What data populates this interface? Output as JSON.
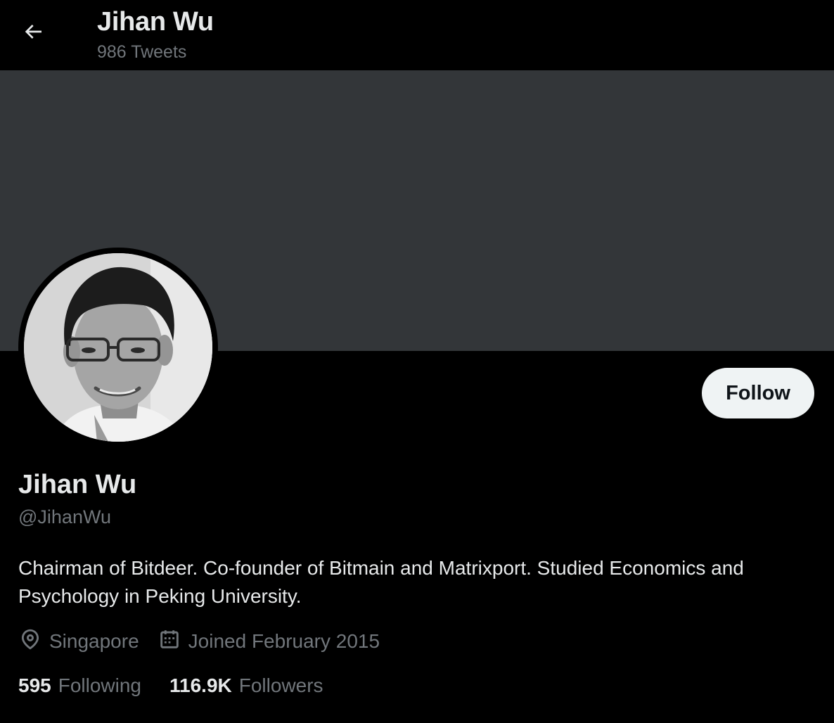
{
  "header": {
    "back_icon": "arrow-left-icon",
    "title": "Jihan Wu",
    "tweet_count": "986 Tweets"
  },
  "banner": {
    "color": "#333639"
  },
  "profile": {
    "name": "Jihan Wu",
    "handle": "@JihanWu",
    "bio": "Chairman of Bitdeer. Co-founder of Bitmain and Matrixport. Studied Economics and Psychology in Peking University.",
    "location": "Singapore",
    "location_icon": "location-pin-icon",
    "joined": "Joined February 2015",
    "joined_icon": "calendar-icon",
    "follow_label": "Follow"
  },
  "stats": {
    "following_count": "595",
    "following_label": "Following",
    "followers_count": "116.9K",
    "followers_label": "Followers"
  },
  "colors": {
    "background": "#000000",
    "text_primary": "#e7e9ea",
    "text_secondary": "#71767b",
    "button_bg": "#eff3f4"
  }
}
